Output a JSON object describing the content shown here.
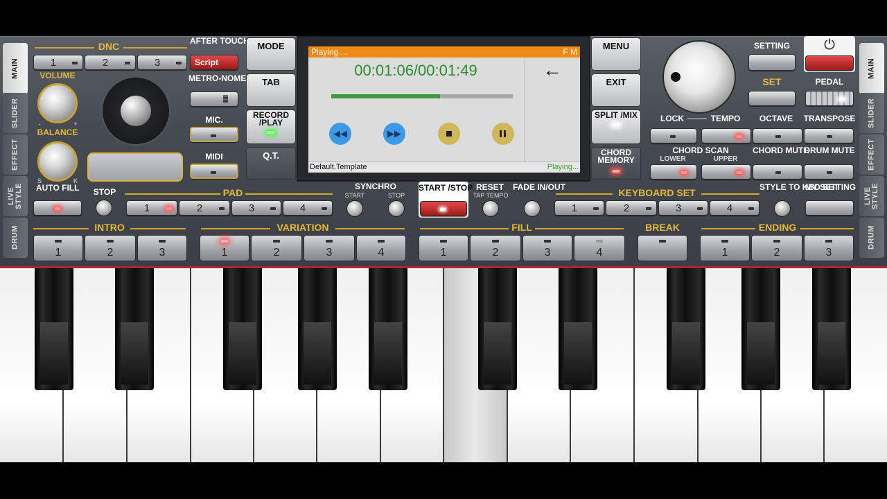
{
  "side_tabs_left": [
    "MAIN",
    "SLIDER",
    "EFFECT",
    "LIVE STYLE",
    "DRUM"
  ],
  "side_tabs_right": [
    "MAIN",
    "SLIDER",
    "EFFECT",
    "LIVE STYLE",
    "DRUM"
  ],
  "dnc": {
    "label": "DNC",
    "buttons": [
      "1",
      "2",
      "3"
    ]
  },
  "after_touch": {
    "label": "AFTER TOUCH",
    "script": "Script"
  },
  "volume": "VOLUME",
  "balance": "BALANCE",
  "balance_minus": "-",
  "balance_plus": "+",
  "knob_s": "S",
  "knob_k": "K",
  "metronome": "METRO-NOME",
  "mic": "MIC.",
  "midi": "MIDI",
  "auto_fill": "AUTO FILL",
  "stop": "STOP",
  "pad": {
    "label": "PAD",
    "buttons": [
      "1",
      "2",
      "3",
      "4"
    ]
  },
  "synchro": {
    "label": "SYNCHRO",
    "start": "START",
    "stop": "STOP"
  },
  "mode": "MODE",
  "tab": "TAB",
  "record_play": "RECORD /PLAY",
  "qt": "Q.T.",
  "start_stop": "START /STOP",
  "reset": "RESET",
  "tap_tempo": "TAP TEMPO",
  "fade": "FADE IN/OUT",
  "menu": "MENU",
  "exit": "EXIT",
  "split_mix": "SPLIT /MIX",
  "chord_memory": "CHORD MEMORY",
  "setting": "SETTING",
  "set": "SET",
  "pedal": "PEDAL",
  "lock": "LOCK",
  "tempo": "TEMPO",
  "octave": "OCTAVE",
  "transpose": "TRANSPOSE",
  "chord_scan": {
    "label": "CHORD SCAN",
    "lower": "LOWER",
    "upper": "UPPER"
  },
  "chord_mute": "CHORD MUTE",
  "drum_mute": "DRUM MUTE",
  "keyboard_set": {
    "label": "KEYBOARD SET",
    "buttons": [
      "1",
      "2",
      "3",
      "4"
    ]
  },
  "style_to_kbd": "STYLE TO KBD SET",
  "my_setting": "MY SETTING",
  "intro": {
    "label": "INTRO",
    "buttons": [
      "1",
      "2",
      "3"
    ]
  },
  "variation": {
    "label": "VARIATION",
    "buttons": [
      "1",
      "2",
      "3",
      "4"
    ]
  },
  "fill": {
    "label": "FILL",
    "buttons": [
      "1",
      "2",
      "3",
      "4"
    ]
  },
  "break": "BREAK",
  "ending": {
    "label": "ENDING",
    "buttons": [
      "1",
      "2",
      "3"
    ]
  },
  "player": {
    "status": "Playing ...",
    "fm": "F M",
    "time": "00:01:06/00:01:49",
    "progress": 0.6,
    "template": "Default.Template",
    "state": "Playing..."
  },
  "colors": {
    "gold": "#e4b93a",
    "accent_orange": "#f08a13",
    "progress_green": "#3c9a3c",
    "time_green": "#2e8b2e",
    "ctrl_blue": "#3d9ae6",
    "ctrl_gold": "#cfb75a"
  }
}
